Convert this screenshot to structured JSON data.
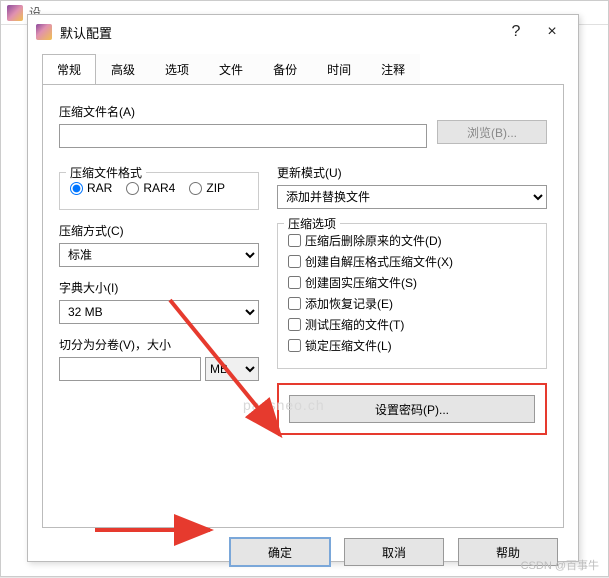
{
  "outer": {
    "title_fragment": "设…"
  },
  "dialog": {
    "title": "默认配置",
    "help_glyph": "?",
    "close_glyph": "×"
  },
  "tabs": [
    "常规",
    "高级",
    "选项",
    "文件",
    "备份",
    "时间",
    "注释"
  ],
  "filename": {
    "label": "压缩文件名(A)",
    "value": "",
    "browse": "浏览(B)..."
  },
  "update_mode": {
    "label": "更新模式(U)",
    "value": "添加并替换文件"
  },
  "format": {
    "legend": "压缩文件格式",
    "options": [
      "RAR",
      "RAR4",
      "ZIP"
    ],
    "selected": "RAR"
  },
  "method": {
    "label": "压缩方式(C)",
    "value": "标准"
  },
  "dict": {
    "label": "字典大小(I)",
    "value": "32 MB"
  },
  "split": {
    "label": "切分为分卷(V)，大小",
    "value": "",
    "unit": "MB"
  },
  "options": {
    "legend": "压缩选项",
    "items": [
      "压缩后删除原来的文件(D)",
      "创建自解压格式压缩文件(X)",
      "创建固实压缩文件(S)",
      "添加恢复记录(E)",
      "测试压缩的文件(T)",
      "锁定压缩文件(L)"
    ]
  },
  "password_btn": "设置密码(P)...",
  "footer": {
    "ok": "确定",
    "cancel": "取消",
    "help": "帮助"
  },
  "watermark": "CSDN @百事牛",
  "watermark2": "passneo.ch"
}
